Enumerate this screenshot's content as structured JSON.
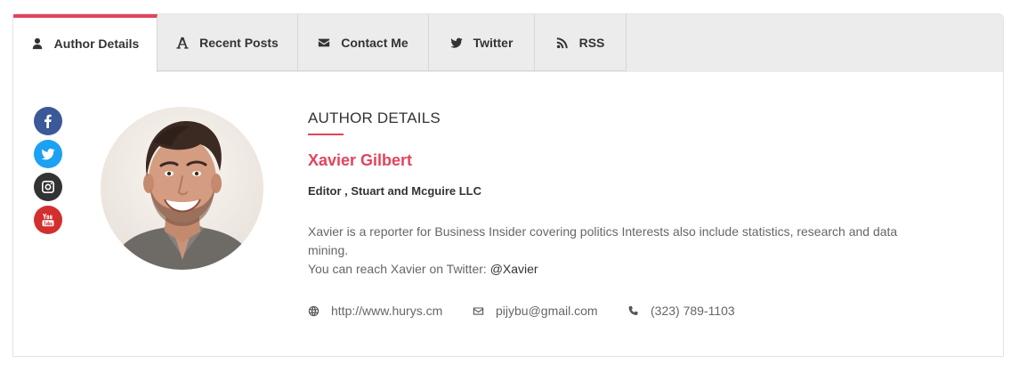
{
  "tabs": [
    {
      "label": "Author Details",
      "icon": "user-icon",
      "active": true
    },
    {
      "label": "Recent Posts",
      "icon": "font-icon",
      "active": false
    },
    {
      "label": "Contact Me",
      "icon": "envelope-icon",
      "active": false
    },
    {
      "label": "Twitter",
      "icon": "twitter-icon",
      "active": false
    },
    {
      "label": "RSS",
      "icon": "rss-icon",
      "active": false
    }
  ],
  "social": [
    {
      "icon": "facebook-icon",
      "color": "#3b5998"
    },
    {
      "icon": "twitter-icon",
      "color": "#1da1f2"
    },
    {
      "icon": "instagram-icon",
      "color": "#333333"
    },
    {
      "icon": "youtube-icon",
      "color": "#d32f2f"
    }
  ],
  "author": {
    "section_heading": "AUTHOR DETAILS",
    "name": "Xavier Gilbert",
    "role": "Editor , Stuart and Mcguire LLC",
    "bio": "Xavier is a reporter for Business Insider covering politics Interests also include statistics, research and data mining.",
    "reach_text": "You can reach Xavier on Twitter: ",
    "twitter_handle": "@Xavier",
    "website": "http://www.hurys.cm",
    "email": "pijybu@gmail.com",
    "phone": "(323) 789-1103"
  },
  "colors": {
    "accent": "#e2445c",
    "tab_bg": "#ececec"
  }
}
